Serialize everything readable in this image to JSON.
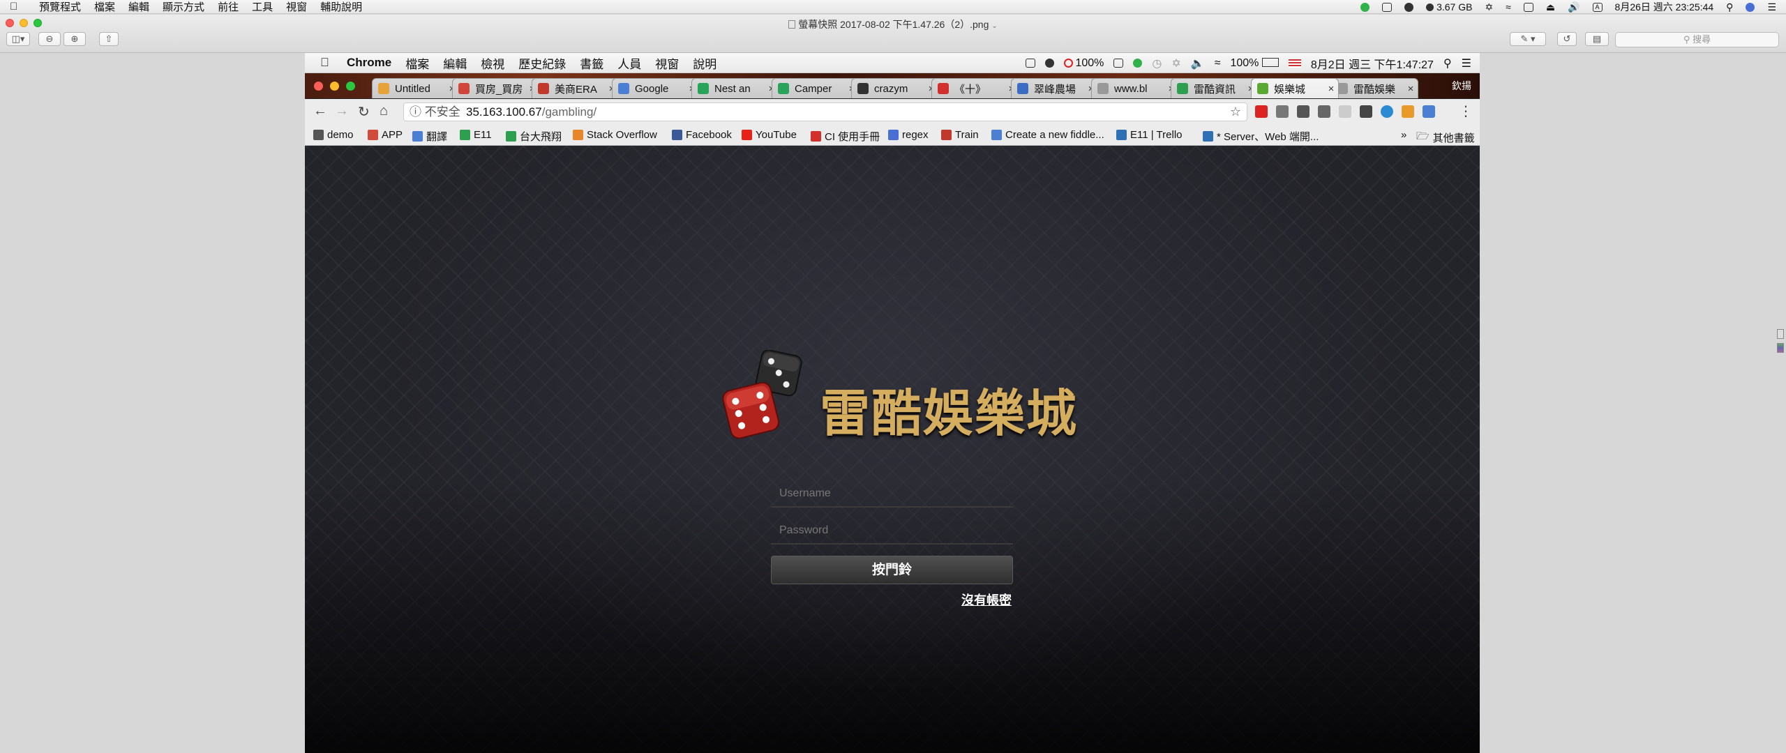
{
  "mac_menubar": {
    "items": [
      "預覽程式",
      "檔案",
      "編輯",
      "顯示方式",
      "前往",
      "工具",
      "視窗",
      "輔助說明"
    ],
    "memory": "3.67 GB",
    "datetime": "8月26日 週六 23:25:44"
  },
  "preview": {
    "title": "螢幕快照 2017-08-02 下午1.47.26（2）.png",
    "search_placeholder": "搜尋"
  },
  "inner_menubar": {
    "app": "Chrome",
    "items": [
      "檔案",
      "編輯",
      "檢視",
      "歷史紀錄",
      "書籤",
      "人員",
      "視窗",
      "說明"
    ],
    "battery_pct": "100%",
    "volume_pct": "100%",
    "datetime": "8月2日 週三 下午1:47:27"
  },
  "browser": {
    "profile": "欽揚",
    "tabs": [
      {
        "title": "Untitled",
        "color": "#e8a23a"
      },
      {
        "title": "買房_買房",
        "color": "#d2453a"
      },
      {
        "title": "美商ERA",
        "color": "#c0392b"
      },
      {
        "title": "Google",
        "color": "#4a7fd4"
      },
      {
        "title": "Nest an",
        "color": "#27a35a"
      },
      {
        "title": "Camper",
        "color": "#27a35a"
      },
      {
        "title": "crazym",
        "color": "#333333"
      },
      {
        "title": "《十》",
        "color": "#d2302c"
      },
      {
        "title": "翠峰農場",
        "color": "#3a6ec2"
      },
      {
        "title": "www.bl",
        "color": "#999999"
      },
      {
        "title": "雷酷資訊",
        "color": "#2e9e4f"
      },
      {
        "title": "娛樂城",
        "color": "#58a832",
        "active": true
      },
      {
        "title": "雷酷娛樂",
        "color": "#999999"
      }
    ],
    "security_label": "不安全",
    "url_host": "35.163.100.67",
    "url_path": "/gambling/",
    "bookmarks": [
      {
        "label": "demo",
        "color": "#555555"
      },
      {
        "label": "APP",
        "color": "#d14b3a"
      },
      {
        "label": "翻譯",
        "color": "#4a7fd4"
      },
      {
        "label": "E11",
        "color": "#2e9e4f"
      },
      {
        "label": "台大飛翔",
        "color": "#2e9e4f"
      },
      {
        "label": "Stack Overflow",
        "color": "#e8862a"
      },
      {
        "label": "Facebook",
        "color": "#3b5998"
      },
      {
        "label": "YouTube",
        "color": "#e62117"
      },
      {
        "label": "CI 使用手冊",
        "color": "#d2302c"
      },
      {
        "label": "regex",
        "color": "#4a6fd4"
      },
      {
        "label": "Train",
        "color": "#c0392b"
      },
      {
        "label": "Create a new fiddle...",
        "color": "#4a7fd4"
      },
      {
        "label": "E11 | Trello",
        "color": "#2f6fb4"
      },
      {
        "label": "* Server、Web 端開...",
        "color": "#2f6fb4"
      }
    ],
    "more_bookmarks": "其他書籤"
  },
  "login_page": {
    "site_title": "雷酷娛樂城",
    "username_placeholder": "Username",
    "password_placeholder": "Password",
    "login_button": "按門鈴",
    "register_link": "沒有帳密",
    "title_color": "#d4ad5f"
  }
}
